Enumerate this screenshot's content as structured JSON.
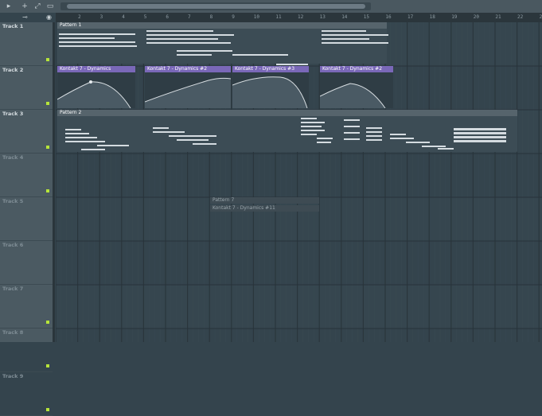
{
  "toolbar": {
    "arrow_icon": "▸",
    "plus_icon": "+",
    "diag_icon": "⤢",
    "box_icon": "▭",
    "slider_icon": "⊸",
    "knob_icon": "◉"
  },
  "ruler": {
    "bars": [
      "2",
      "3",
      "4",
      "5",
      "6",
      "7",
      "8",
      "9",
      "10",
      "11",
      "12",
      "13",
      "14",
      "15",
      "16",
      "17",
      "18",
      "19",
      "20",
      "21",
      "22",
      "23"
    ]
  },
  "tracks": [
    {
      "name": "Track 1",
      "led": true
    },
    {
      "name": "Track 2",
      "led": true
    },
    {
      "name": "Track 3",
      "led": true
    },
    {
      "name": "Track 4",
      "led": true,
      "dim": true
    },
    {
      "name": "Track 5",
      "led": false,
      "dim": true
    },
    {
      "name": "Track 6",
      "led": false,
      "dim": true
    },
    {
      "name": "Track 7",
      "led": true,
      "dim": true
    },
    {
      "name": "Track 8",
      "led": true,
      "dim": true
    },
    {
      "name": "Track 9",
      "led": true,
      "dim": true
    }
  ],
  "clips": {
    "pattern1": "Pattern 1",
    "pattern2": "Pattern 2",
    "auto1": "Kontakt 7 - Dynamics",
    "auto2": "Kontakt 7 - Dynamics #2",
    "auto3": "Kontakt 7 - Dynamics #3",
    "auto4": "Kontakt 7 - Dynamics #2"
  },
  "ghosts": {
    "pattern": "Pattern 7",
    "auto": "Kontakt 7 - Dynamics #11"
  },
  "colors": {
    "accent_led": "#b6e43a",
    "automation_header": "#7a68b8",
    "pattern_header": "#56646c"
  }
}
